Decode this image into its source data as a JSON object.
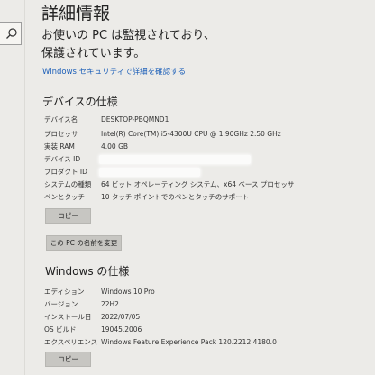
{
  "header": {
    "title": "詳細情報",
    "protection_status": "お使いの PC は監視されており、保護されています。",
    "security_link": "Windows セキュリティで詳細を確認する"
  },
  "device_specs": {
    "heading": "デバイスの仕様",
    "rows": [
      {
        "label": "デバイス名",
        "value": "DESKTOP-PBQMND1"
      },
      {
        "label": "プロセッサ",
        "value": "Intel(R) Core(TM) i5-4300U CPU @ 1.90GHz   2.50 GHz"
      },
      {
        "label": "実装 RAM",
        "value": "4.00 GB"
      },
      {
        "label": "デバイス ID",
        "value": ""
      },
      {
        "label": "プロダクト ID",
        "value": ""
      },
      {
        "label": "システムの種類",
        "value": "64 ビット オペレーティング システム、x64 ベース プロセッサ"
      },
      {
        "label": "ペンとタッチ",
        "value": "10 タッチ ポイントでのペンとタッチのサポート"
      }
    ],
    "copy_button": "コピー",
    "rename_button": "この PC の名前を変更"
  },
  "windows_specs": {
    "heading": "Windows の仕様",
    "rows": [
      {
        "label": "エディション",
        "value": "Windows 10 Pro"
      },
      {
        "label": "バージョン",
        "value": "22H2"
      },
      {
        "label": "インストール日",
        "value": "2022/07/05"
      },
      {
        "label": "OS ビルド",
        "value": "19045.2006"
      },
      {
        "label": "エクスペリエンス",
        "value": "Windows Feature Experience Pack 120.2212.4180.0"
      }
    ],
    "copy_button": "コピー"
  },
  "icons": {
    "search": "search-icon"
  }
}
